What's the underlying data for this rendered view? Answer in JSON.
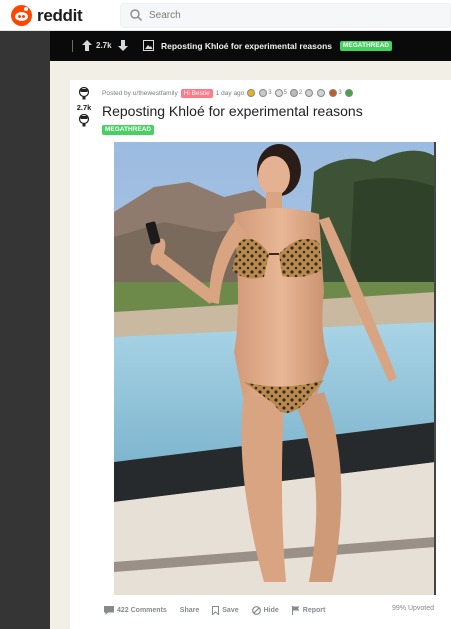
{
  "header": {
    "brand": "reddit",
    "search_placeholder": "Search"
  },
  "sticky_bar": {
    "score": "2.7k",
    "title": "Reposting Khloé for experimental reasons",
    "flair": "MEGATHREAD"
  },
  "post": {
    "score": "2.7k",
    "posted_by_prefix": "Posted by",
    "username": "u/thewestfamily",
    "user_flair": "Hi Bestie",
    "time": "1 day ago",
    "awards": [
      {
        "icon": "gold-award-icon",
        "color": "#e8b41c",
        "count": ""
      },
      {
        "icon": "wholesome-award-icon",
        "color": "#c9c9c9",
        "count": "3"
      },
      {
        "icon": "helpful-award-icon",
        "color": "#dddddd",
        "count": "5"
      },
      {
        "icon": "platinum-award-icon",
        "color": "#bbbbbb",
        "count": "2"
      },
      {
        "icon": "face-award-icon",
        "color": "#cfcfcf",
        "count": ""
      },
      {
        "icon": "mind-blown-award-icon",
        "color": "#d3d3d3",
        "count": ""
      },
      {
        "icon": "bear-award-icon",
        "color": "#c45a2a",
        "count": "3"
      },
      {
        "icon": "plant-award-icon",
        "color": "#46a34a",
        "count": ""
      }
    ],
    "title": "Reposting Khloé for experimental reasons",
    "flair": "MEGATHREAD",
    "image_alt": "photo",
    "actions": {
      "comments": "422 Comments",
      "share": "Share",
      "save": "Save",
      "hide": "Hide",
      "report": "Report"
    },
    "upvoted": "99% Upvoted"
  },
  "colors": {
    "brand_orange": "#ff4500",
    "megathread_green": "#46d160",
    "user_flair_pink": "#ff7a8a"
  }
}
